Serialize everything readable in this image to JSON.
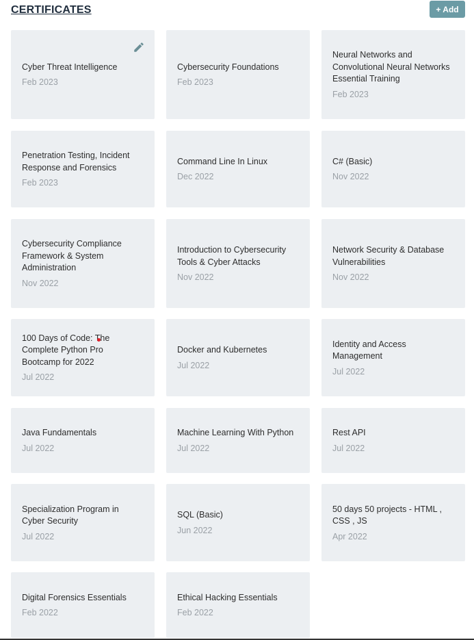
{
  "header": {
    "title": "CERTIFICATES",
    "add_label": "+ Add"
  },
  "icons": {
    "edit": "pencil-icon"
  },
  "colors": {
    "card_bg": "#eceff2",
    "accent": "#6b9ba5",
    "date_text": "#9aa0a6",
    "marker": "#e0202a"
  },
  "certificates": [
    {
      "name": "Cyber Threat Intelligence",
      "date": "Feb 2023"
    },
    {
      "name": "Cybersecurity Foundations",
      "date": "Feb 2023"
    },
    {
      "name": "Neural Networks and Convolutional Neural Networks Essential Training",
      "date": "Feb 2023"
    },
    {
      "name": "Penetration Testing, Incident Response and Forensics",
      "date": "Feb 2023"
    },
    {
      "name": "Command Line In Linux",
      "date": "Dec 2022"
    },
    {
      "name": "C# (Basic)",
      "date": "Nov 2022"
    },
    {
      "name": "Cybersecurity Compliance Framework & System Administration",
      "date": "Nov 2022"
    },
    {
      "name": "Introduction to Cybersecurity Tools & Cyber Attacks",
      "date": "Nov 2022"
    },
    {
      "name": "Network Security & Database Vulnerabilities",
      "date": "Nov 2022"
    },
    {
      "name": "100 Days of Code: The Complete Python Pro Bootcamp for 2022",
      "date": "Jul 2022"
    },
    {
      "name": "Docker and Kubernetes",
      "date": "Jul 2022"
    },
    {
      "name": "Identity and Access Management",
      "date": "Jul 2022"
    },
    {
      "name": "Java Fundamentals",
      "date": "Jul 2022"
    },
    {
      "name": "Machine Learning With Python",
      "date": "Jul 2022"
    },
    {
      "name": "Rest API",
      "date": "Jul 2022"
    },
    {
      "name": "Specialization Program in Cyber Security",
      "date": "Jul 2022"
    },
    {
      "name": "SQL (Basic)",
      "date": "Jun 2022"
    },
    {
      "name": "50 days 50 projects - HTML , CSS , JS",
      "date": "Apr 2022"
    },
    {
      "name": "Digital Forensics Essentials",
      "date": "Feb 2022"
    },
    {
      "name": "Ethical Hacking Essentials",
      "date": "Feb 2022"
    }
  ]
}
